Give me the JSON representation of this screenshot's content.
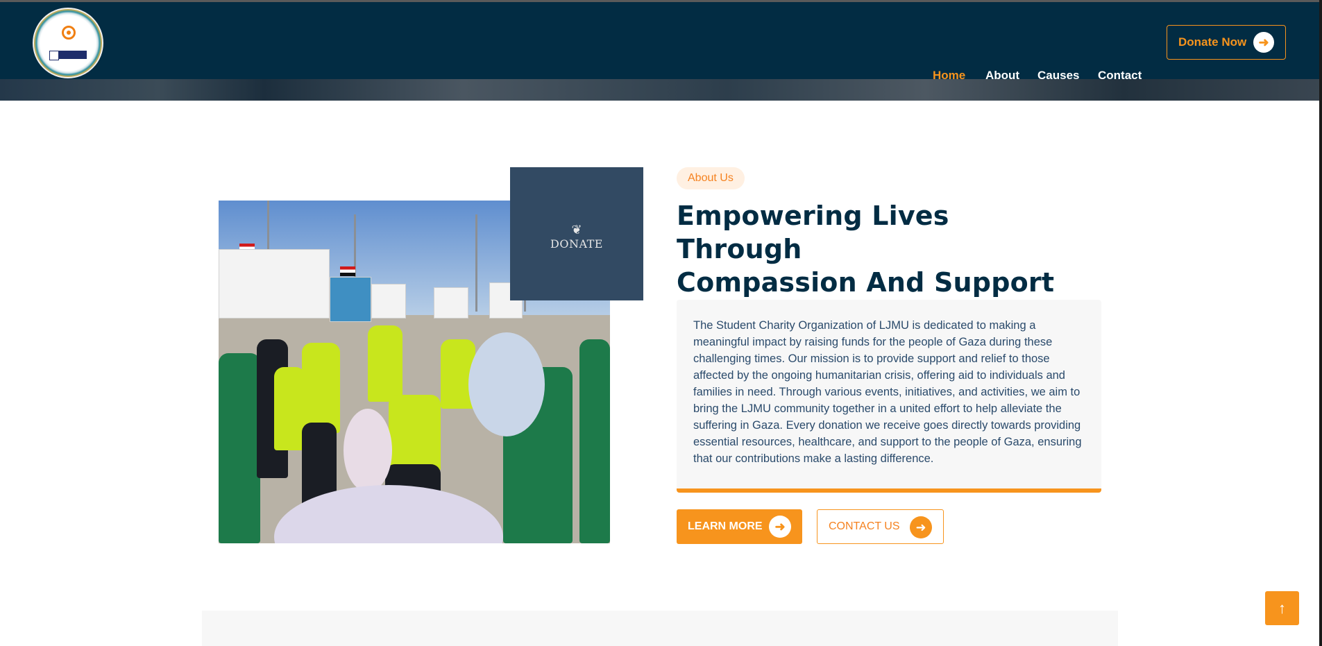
{
  "header": {
    "nav": [
      "Home",
      "About",
      "Causes",
      "Contact"
    ],
    "donate_label": "Donate Now"
  },
  "about": {
    "badge": "About Us",
    "title_line1": "Empowering Lives Through",
    "title_line2": "Compassion And Support",
    "description": "The Student Charity Organization of LJMU is dedicated to making a meaningful impact by raising funds for the people of Gaza during these challenging times. Our mission is to provide support and relief to those affected by the ongoing humanitarian crisis, offering aid to individuals and families in need. Through various events, initiatives, and activities, we aim to bring the LJMU community together in a united effort to help alleviate the suffering in Gaza. Every donation we receive goes directly towards providing essential resources, healthcare, and support to the people of Gaza, ensuring that our contributions make a lasting difference.",
    "donate_card_text": "DONATE",
    "learn_more": "LEARN MORE",
    "contact_us": "CONTACT US"
  },
  "icons": {
    "arrow": "arrow-right-icon",
    "scroll": "arrow-up-icon"
  },
  "colors": {
    "header_bg": "#022c43",
    "accent": "#f7941d",
    "title": "#022c43",
    "text": "#2a4a6b"
  }
}
